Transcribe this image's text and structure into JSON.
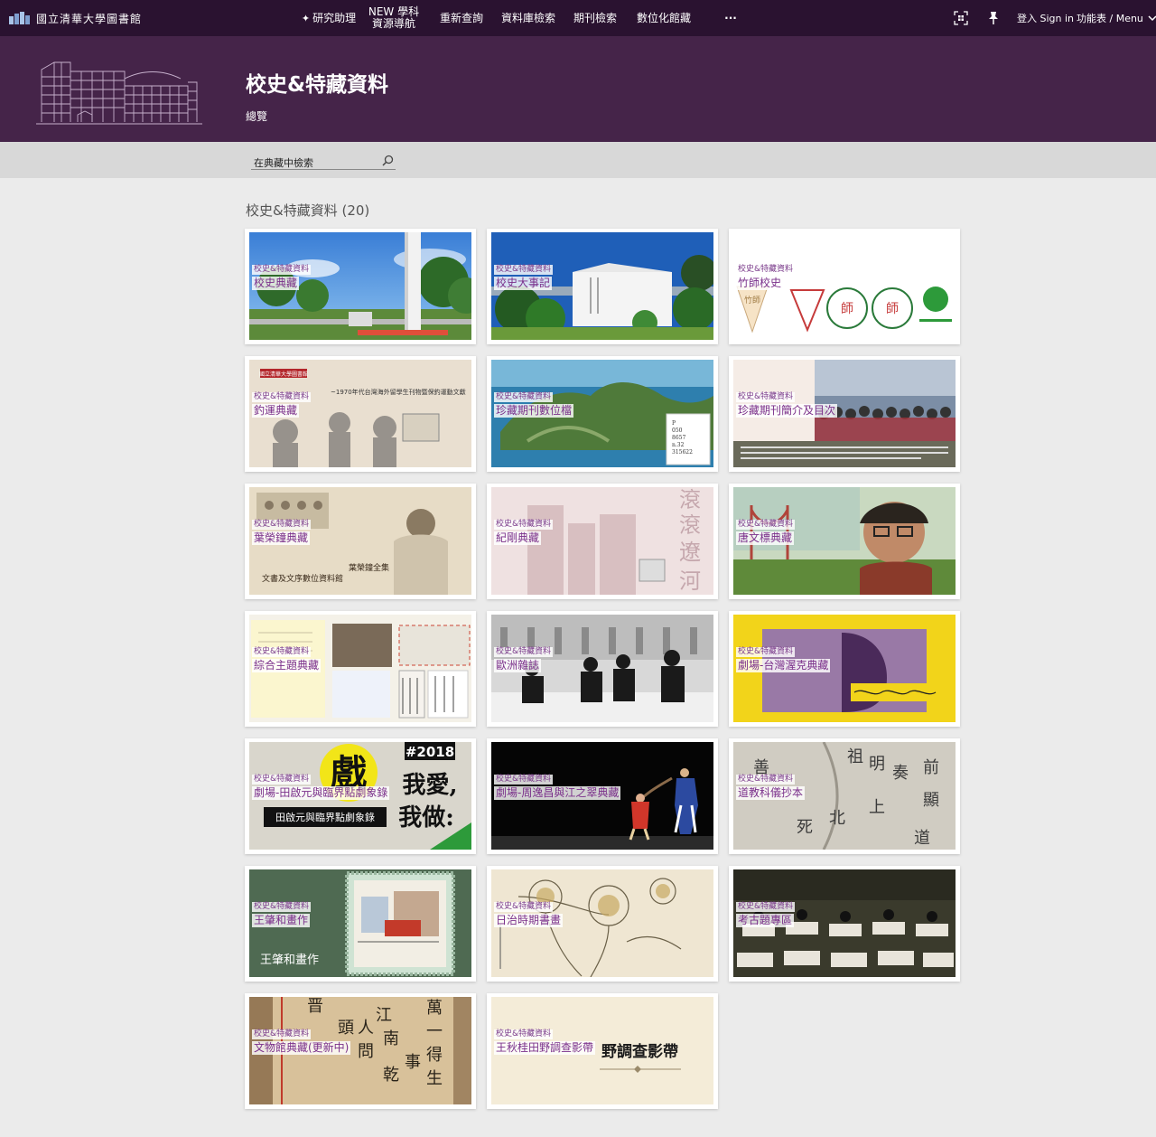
{
  "nav": {
    "logo_text": "國立清華大學圖書館",
    "items": [
      {
        "icon": "sparkle-icon",
        "label": "研究助理"
      },
      {
        "line1": "NEW 學科",
        "line2": "資源導航"
      },
      {
        "label": "重新查詢"
      },
      {
        "label": "資料庫檢索"
      },
      {
        "label": "期刊檢索"
      },
      {
        "label": "數位化館藏"
      },
      {
        "label": "···"
      }
    ],
    "qr_icon": "qr-code-icon",
    "pin_icon": "pin-icon",
    "signin": "登入 Sign in",
    "menu": "功能表 / Menu",
    "menu_icon": "chevron-down-icon"
  },
  "hero": {
    "title": "校史&特藏資料",
    "subtitle": "總覽"
  },
  "search": {
    "placeholder": "在典藏中檢索",
    "icon": "search-icon"
  },
  "section": {
    "title": "校史&特藏資料 (20)"
  },
  "cards": [
    {
      "tag": "校史&特藏資料",
      "name": "校史典藏"
    },
    {
      "tag": "校史&特藏資料",
      "name": "校史大事記"
    },
    {
      "tag": "校史&特藏資料",
      "name": "竹師校史"
    },
    {
      "tag": "校史&特藏資料",
      "name": "釣運典藏"
    },
    {
      "tag": "校史&特藏資料",
      "name": "珍藏期刊數位檔"
    },
    {
      "tag": "校史&特藏資料",
      "name": "珍藏期刊簡介及目次"
    },
    {
      "tag": "校史&特藏資料",
      "name": "葉榮鐘典藏"
    },
    {
      "tag": "校史&特藏資料",
      "name": "紀剛典藏"
    },
    {
      "tag": "校史&特藏資料",
      "name": "唐文標典藏"
    },
    {
      "tag": "校史&特藏資料",
      "name": "綜合主題典藏"
    },
    {
      "tag": "校史&特藏資料",
      "name": "歐洲雜誌"
    },
    {
      "tag": "校史&特藏資料",
      "name": "劇場-台灣渥克典藏"
    },
    {
      "tag": "校史&特藏資料",
      "name": "劇場-田啟元與臨界點劇象錄"
    },
    {
      "tag": "校史&特藏資料",
      "name": "劇場-周逸昌與江之翠典藏"
    },
    {
      "tag": "校史&特藏資料",
      "name": "道教科儀抄本"
    },
    {
      "tag": "校史&特藏資料",
      "name": "王肇和畫作"
    },
    {
      "tag": "校史&特藏資料",
      "name": "日治時期書畫"
    },
    {
      "tag": "校史&特藏資料",
      "name": "考古題專區"
    },
    {
      "tag": "校史&特藏資料",
      "name": "文物館典藏(更新中)"
    },
    {
      "tag": "校史&特藏資料",
      "name": "王秋桂田野調查影帶"
    }
  ],
  "card_images": {
    "c3": [
      "竹師",
      "師",
      "師",
      "師"
    ],
    "c4_banner": "國立清華大學圖書館",
    "c4_caption": "~1970年代台灣海外留學生刊物暨保釣運動文獻",
    "c5_label": [
      "P",
      "050",
      "8657",
      "n.32",
      "315622"
    ],
    "c7_caption": [
      "葉榮鐘全集",
      "文書及文序數位資料館"
    ],
    "c8_big": [
      "滾",
      "滾",
      "遼",
      "河"
    ],
    "c13_hash": "#2018",
    "c13_big": [
      "我愛,",
      "我做:"
    ],
    "c13_band": "田啟元與臨界點劇象錄",
    "c13_char": "戲",
    "c15_text": [
      "祖",
      "明",
      "奏",
      "前",
      "善",
      "上",
      "顯",
      "北",
      "死",
      "道"
    ],
    "c16_caption": "王肇和畫作",
    "c19_text": [
      "晋",
      "萬",
      "江",
      "頭",
      "人",
      "一",
      "問",
      "南",
      "得",
      "生",
      "乾",
      "事"
    ],
    "c20_text": "野調查影帶"
  }
}
